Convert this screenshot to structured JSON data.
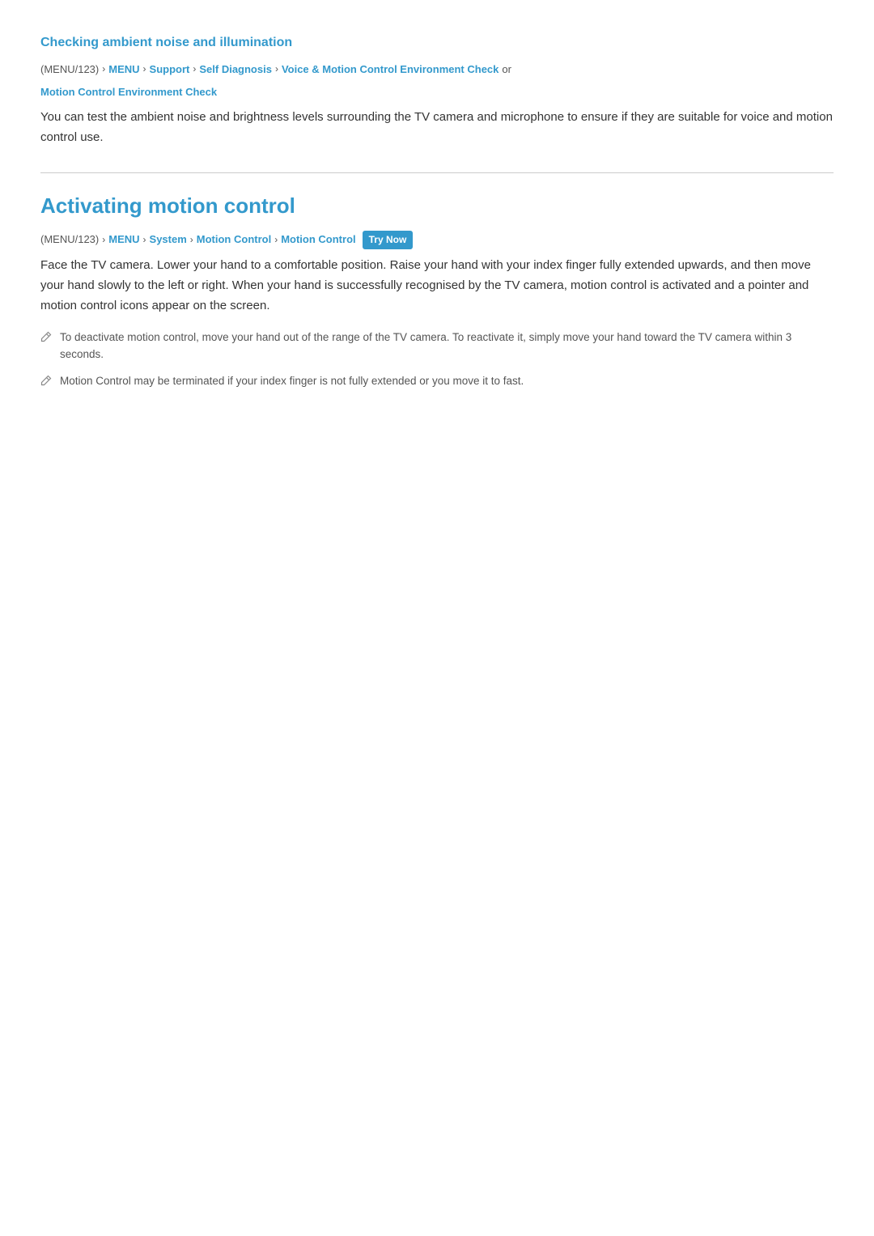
{
  "section1": {
    "title": "Checking ambient noise and illumination",
    "breadcrumb": {
      "items": [
        {
          "text": "(MENU/123)",
          "type": "plain"
        },
        {
          "text": "›",
          "type": "arrow"
        },
        {
          "text": "MENU",
          "type": "link"
        },
        {
          "text": "›",
          "type": "arrow"
        },
        {
          "text": "Support",
          "type": "link"
        },
        {
          "text": "›",
          "type": "arrow"
        },
        {
          "text": "Self Diagnosis",
          "type": "link"
        },
        {
          "text": "›",
          "type": "arrow"
        },
        {
          "text": "Voice & Motion Control Environment Check",
          "type": "link"
        },
        {
          "text": "or",
          "type": "plain"
        }
      ],
      "second_line": "Motion Control Environment Check"
    },
    "body": "You can test the ambient noise and brightness levels surrounding the TV camera and microphone to ensure if they are suitable for voice and motion control use."
  },
  "section2": {
    "title": "Activating motion control",
    "breadcrumb": {
      "items": [
        {
          "text": "(MENU/123)",
          "type": "plain"
        },
        {
          "text": "›",
          "type": "arrow"
        },
        {
          "text": "MENU",
          "type": "link"
        },
        {
          "text": "›",
          "type": "arrow"
        },
        {
          "text": "System",
          "type": "link"
        },
        {
          "text": "›",
          "type": "arrow"
        },
        {
          "text": "Motion Control",
          "type": "link"
        },
        {
          "text": "›",
          "type": "arrow"
        },
        {
          "text": "Motion Control",
          "type": "link"
        }
      ],
      "try_now": "Try Now"
    },
    "body": "Face the TV camera. Lower your hand to a comfortable position. Raise your hand with your index finger fully extended upwards, and then move your hand slowly to the left or right. When your hand is successfully recognised by the TV camera, motion control is activated and a pointer and motion control icons appear on the screen.",
    "notes": [
      "To deactivate motion control, move your hand out of the range of the TV camera. To reactivate it, simply move your hand toward the TV camera within 3 seconds.",
      "Motion Control may be terminated if your index finger is not fully extended or you move it to fast."
    ]
  }
}
